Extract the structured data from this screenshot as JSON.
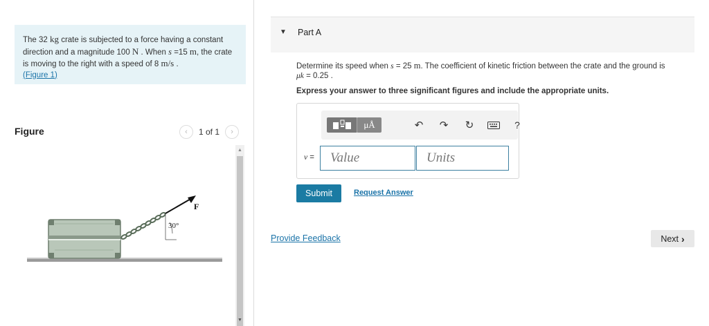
{
  "problem": {
    "text_1": "The 32 ",
    "mass_unit": "kg",
    "text_2": " crate is subjected to a force having a constant direction and a magnitude 100 ",
    "force_unit": "N",
    "text_3": " . When ",
    "s_var": "s",
    "text_4": " =15 ",
    "dist_unit": "m",
    "text_5": ", the crate is moving to the right with a speed of 8 ",
    "speed_unit": "m/s",
    "text_6": " .",
    "figure_link": "(Figure 1)"
  },
  "figure": {
    "title": "Figure",
    "pager": "1 of 1",
    "prev_icon": "‹",
    "next_icon": "›",
    "angle_label": "30°",
    "force_label": "F"
  },
  "part": {
    "title": "Part A",
    "caret": "▼"
  },
  "question": {
    "text_1": "Determine its speed when ",
    "s_var": "s",
    "text_2": " = 25 ",
    "unit": "m",
    "text_3": ". The coefficient of kinetic friction between the crate and the ground is",
    "mu": "μk",
    "text_4": " = 0.25 .",
    "instruction": "Express your answer to three significant figures and include the appropriate units."
  },
  "answer": {
    "var": "v",
    "eq": " =",
    "value_placeholder": "Value",
    "units_placeholder": "Units",
    "toolbar": {
      "units_label": "μÅ",
      "undo": "↶",
      "redo": "↷",
      "reset": "↻",
      "help": "?"
    }
  },
  "actions": {
    "submit": "Submit",
    "request_answer": "Request Answer",
    "provide_feedback": "Provide Feedback",
    "next": "Next",
    "next_chev": "›"
  },
  "colors": {
    "accent": "#1b7ba3",
    "link": "#1a73a8",
    "problem_bg": "#e6f3f7"
  }
}
